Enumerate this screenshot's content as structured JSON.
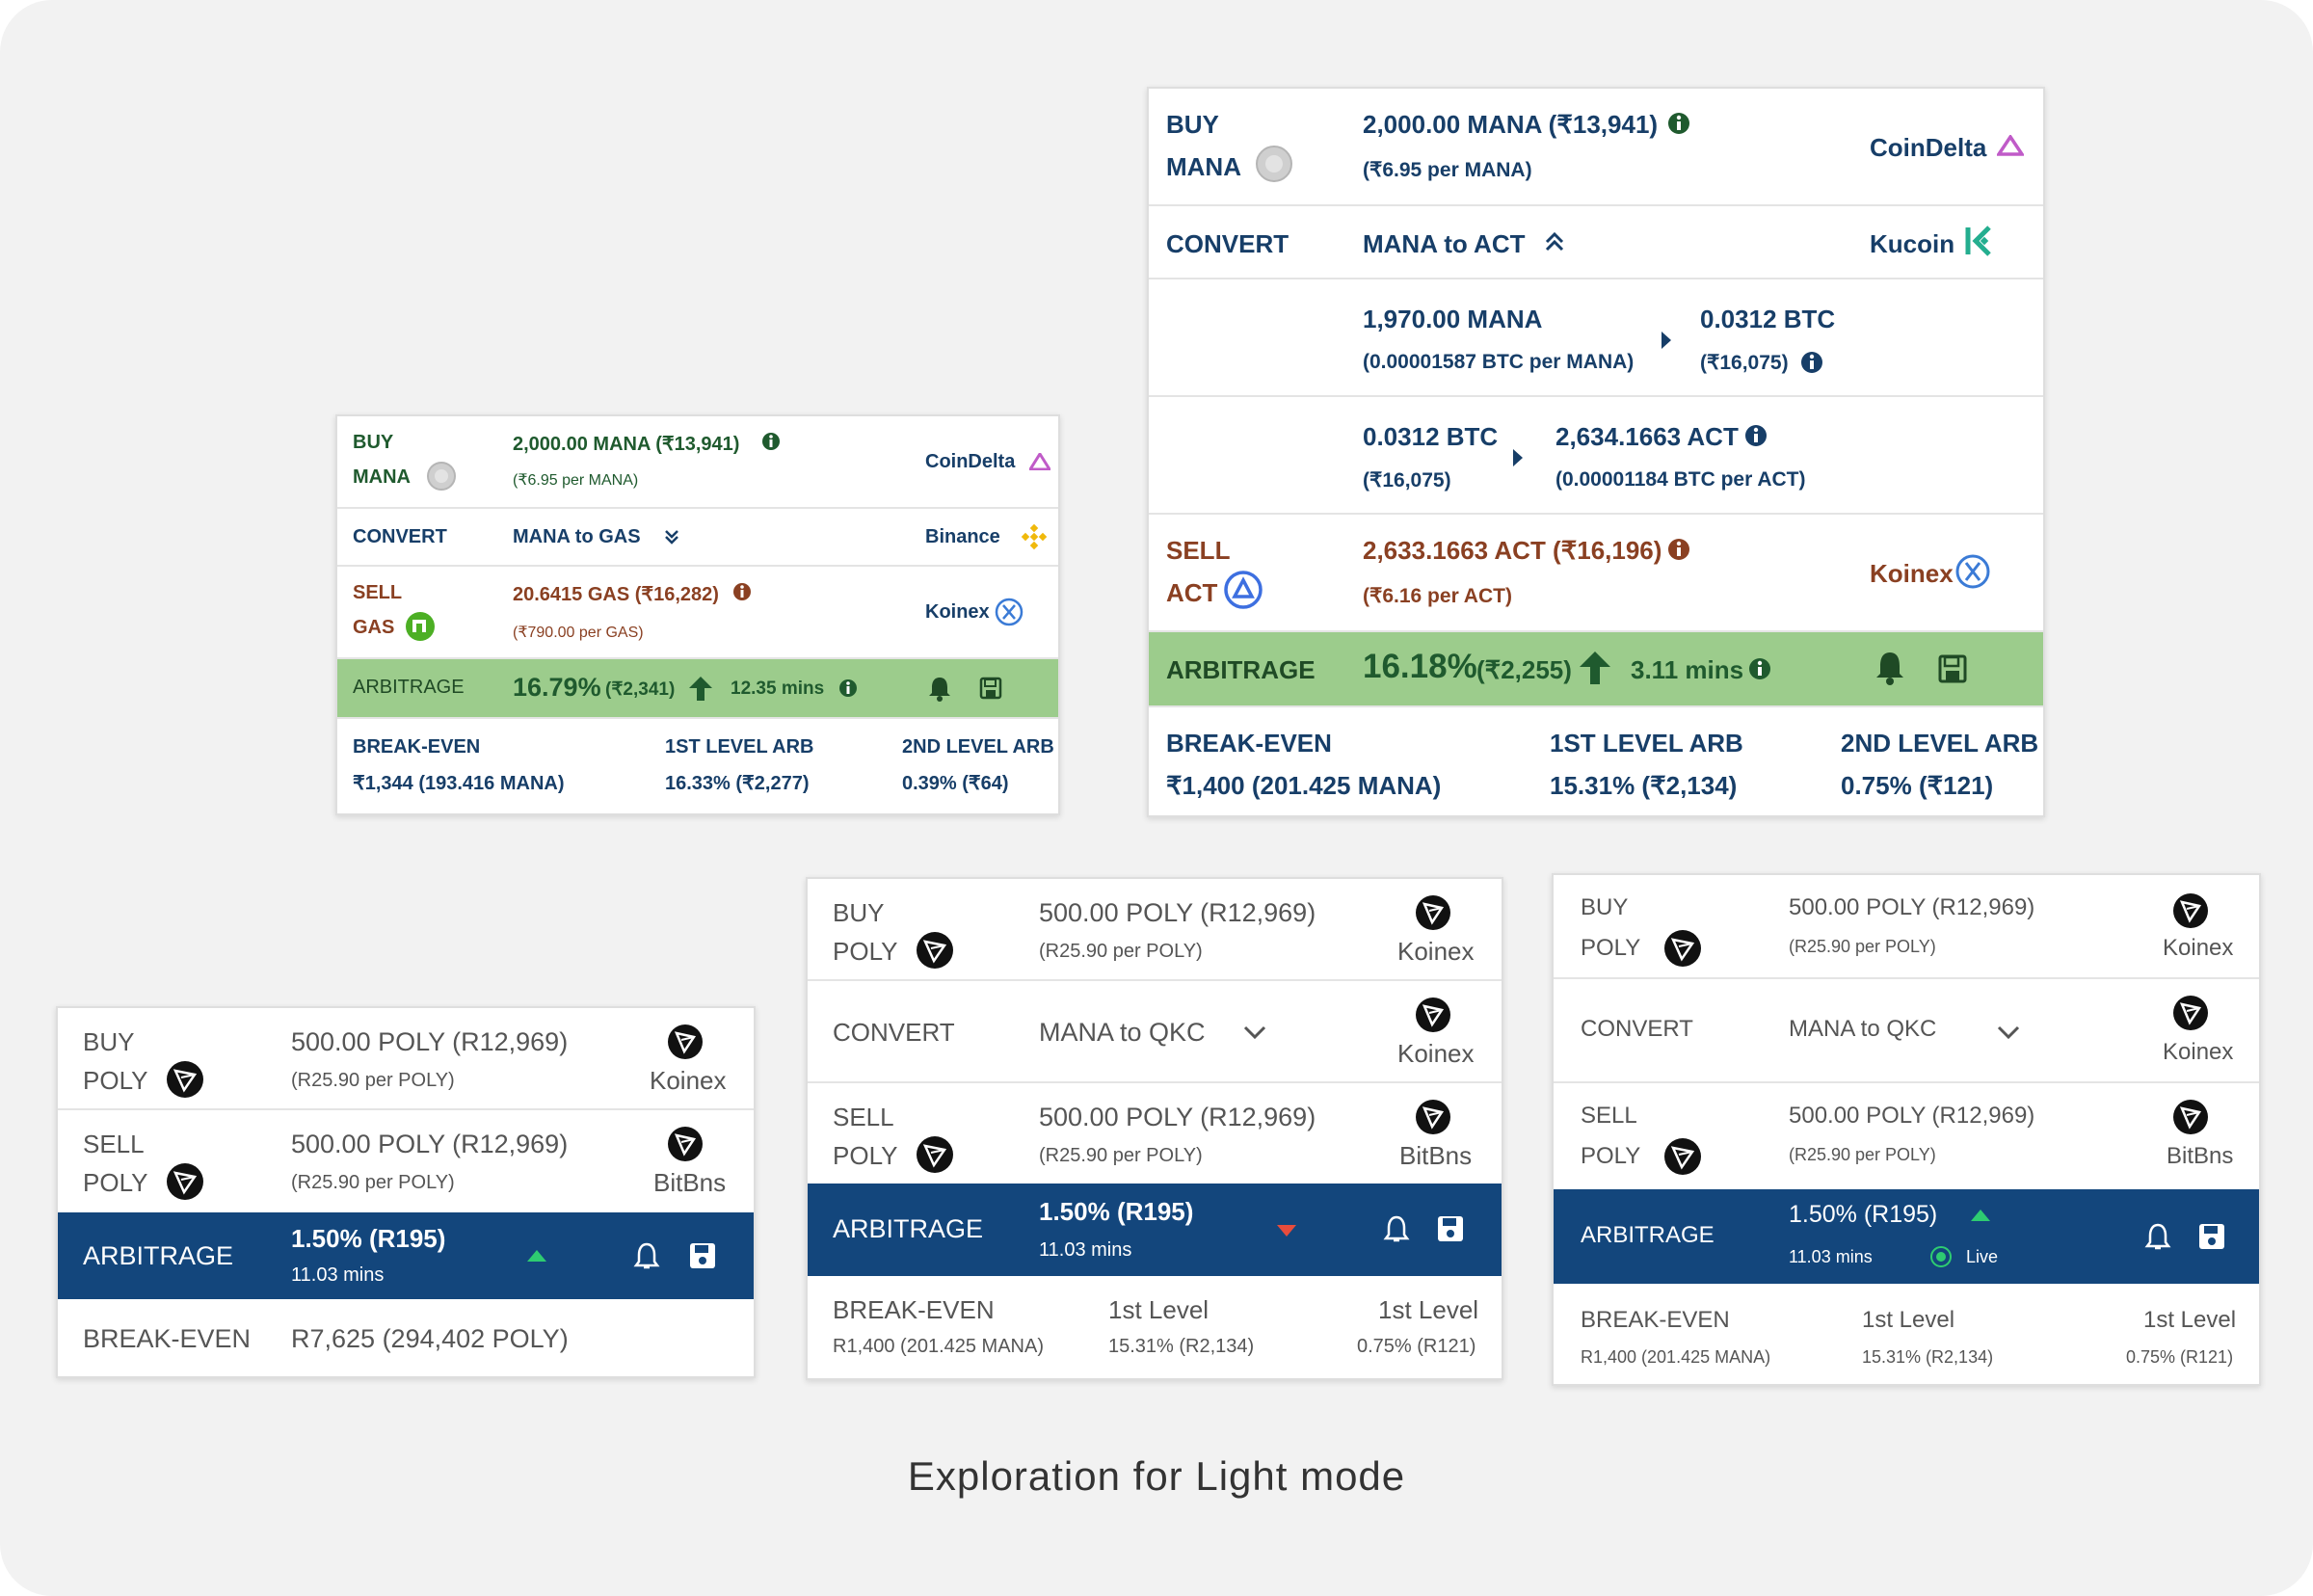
{
  "caption": "Exploration for Light mode",
  "colors": {
    "navy": "#13467c",
    "arb_green": "#9ccc8c",
    "text_navy": "#173e68",
    "sell_brown": "#8a4022"
  },
  "card1": {
    "buy_label_1": "BUY",
    "buy_label_2": "MANA",
    "buy_amount": "2,000.00 MANA (₹13,941)",
    "buy_rate": "(₹6.95 per MANA)",
    "buy_exchange": "CoinDelta",
    "convert_label": "CONVERT",
    "convert_pair": "MANA to GAS",
    "convert_exchange": "Binance",
    "sell_label_1": "SELL",
    "sell_label_2": "GAS",
    "sell_amount": "20.6415 GAS (₹16,282)",
    "sell_rate": "(₹790.00 per GAS)",
    "sell_exchange": "Koinex",
    "arb_label": "ARBITRAGE",
    "arb_pct": "16.79%",
    "arb_value": "(₹2,341)",
    "arb_time": "12.35 mins",
    "be_label": "BREAK-EVEN",
    "be_value": "₹1,344 (193.416 MANA)",
    "l1_label": "1ST LEVEL ARB",
    "l1_value": "16.33% (₹2,277)",
    "l2_label": "2ND LEVEL ARB",
    "l2_value": "0.39% (₹64)"
  },
  "card2": {
    "buy_label_1": "BUY",
    "buy_label_2": "MANA",
    "buy_amount": "2,000.00 MANA (₹13,941)",
    "buy_rate": "(₹6.95 per MANA)",
    "buy_exchange": "CoinDelta",
    "convert_label": "CONVERT",
    "convert_pair": "MANA to ACT",
    "convert_exchange": "Kucoin",
    "step1_from": "1,970.00 MANA",
    "step1_from_rate": "(0.00001587 BTC per MANA)",
    "step1_to": "0.0312 BTC",
    "step1_to_sub": "(₹16,075)",
    "step2_from": "0.0312 BTC",
    "step2_from_sub": "(₹16,075)",
    "step2_to": "2,634.1663 ACT",
    "step2_to_rate": "(0.00001184 BTC per ACT)",
    "sell_label_1": "SELL",
    "sell_label_2": "ACT",
    "sell_amount": "2,633.1663 ACT (₹16,196)",
    "sell_rate": "(₹6.16 per ACT)",
    "sell_exchange": "Koinex",
    "arb_label": "ARBITRAGE",
    "arb_pct": "16.18%",
    "arb_value": "(₹2,255)",
    "arb_time": "3.11 mins",
    "be_label": "BREAK-EVEN",
    "be_value": "₹1,400 (201.425 MANA)",
    "l1_label": "1ST LEVEL ARB",
    "l1_value": "15.31% (₹2,134)",
    "l2_label": "2ND LEVEL ARB",
    "l2_value": "0.75% (₹121)"
  },
  "card3": {
    "buy_label_1": "BUY",
    "buy_label_2": "POLY",
    "buy_amount": "500.00 POLY (R12,969)",
    "buy_rate": "(R25.90 per POLY)",
    "buy_exchange": "Koinex",
    "sell_label_1": "SELL",
    "sell_label_2": "POLY",
    "sell_amount": "500.00 POLY (R12,969)",
    "sell_rate": "(R25.90 per POLY)",
    "sell_exchange": "BitBns",
    "arb_label": "ARBITRAGE",
    "arb_value": "1.50% (R195)",
    "arb_time": "11.03 mins",
    "be_label": "BREAK-EVEN",
    "be_value": "R7,625 (294,402 POLY)"
  },
  "card4": {
    "buy_label_1": "BUY",
    "buy_label_2": "POLY",
    "buy_amount": "500.00 POLY (R12,969)",
    "buy_rate": "(R25.90 per POLY)",
    "buy_exchange": "Koinex",
    "convert_label": "CONVERT",
    "convert_pair": "MANA to QKC",
    "convert_exchange": "Koinex",
    "sell_label_1": "SELL",
    "sell_label_2": "POLY",
    "sell_amount": "500.00 POLY (R12,969)",
    "sell_rate": "(R25.90 per POLY)",
    "sell_exchange": "BitBns",
    "arb_label": "ARBITRAGE",
    "arb_value": "1.50% (R195)",
    "arb_time": "11.03 mins",
    "be_label": "BREAK-EVEN",
    "be_value": "R1,400 (201.425 MANA)",
    "l1_label": "1st Level",
    "l1_value": "15.31% (R2,134)",
    "l2_label": "1st Level",
    "l2_value": "0.75% (R121)"
  },
  "card5": {
    "buy_label_1": "BUY",
    "buy_label_2": "POLY",
    "buy_amount": "500.00 POLY (R12,969)",
    "buy_rate": "(R25.90 per POLY)",
    "buy_exchange": "Koinex",
    "convert_label": "CONVERT",
    "convert_pair": "MANA to QKC",
    "convert_exchange": "Koinex",
    "sell_label_1": "SELL",
    "sell_label_2": "POLY",
    "sell_amount": "500.00 POLY (R12,969)",
    "sell_rate": "(R25.90 per POLY)",
    "sell_exchange": "BitBns",
    "arb_label": "ARBITRAGE",
    "arb_value": "1.50% (R195)",
    "arb_time": "11.03 mins",
    "arb_status": "Live",
    "be_label": "BREAK-EVEN",
    "be_value": "R1,400 (201.425 MANA)",
    "l1_label": "1st Level",
    "l1_value": "15.31% (R2,134)",
    "l2_label": "1st Level",
    "l2_value": "0.75% (R121)"
  }
}
